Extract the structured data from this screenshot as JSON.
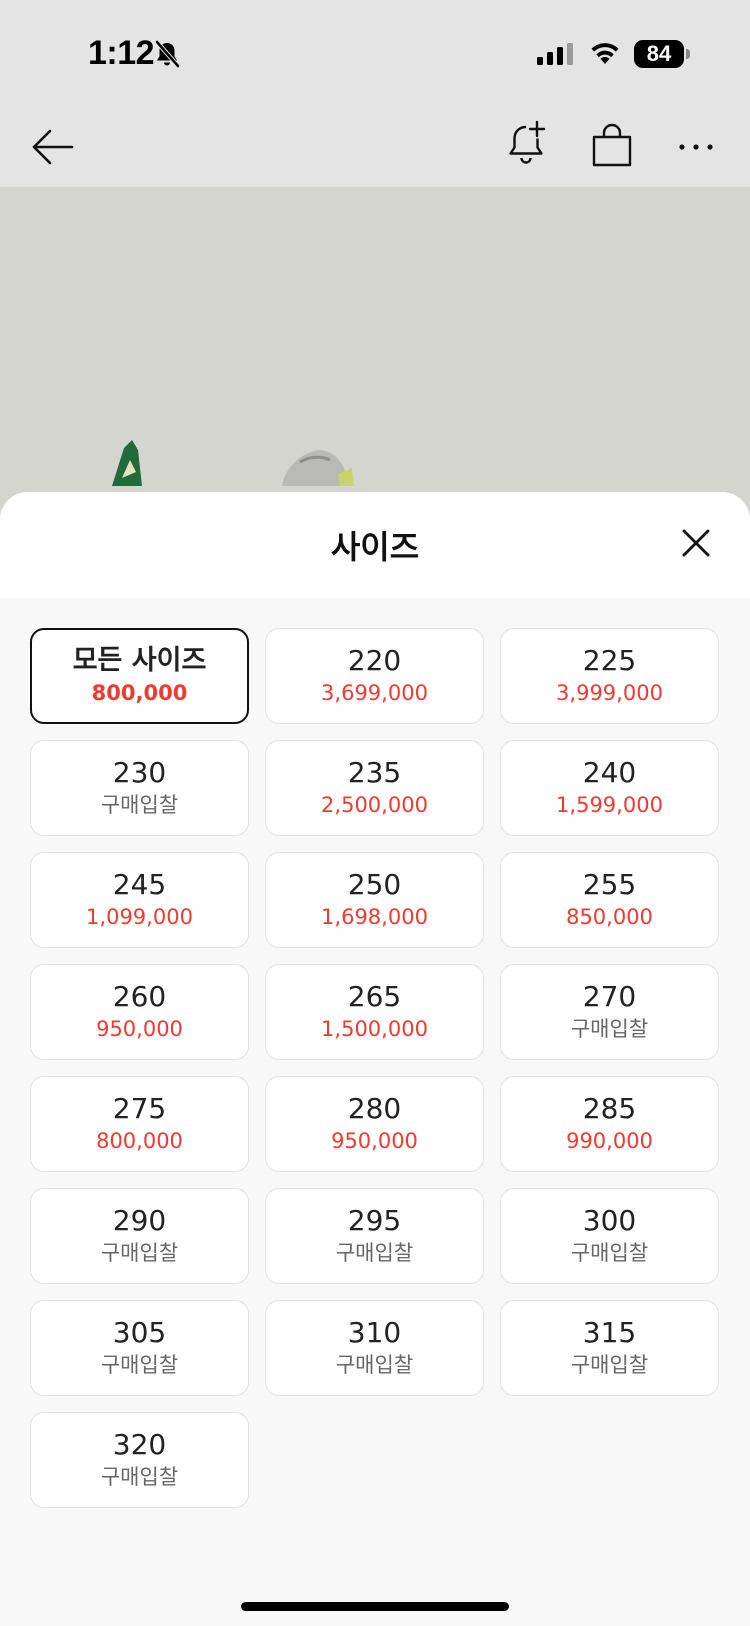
{
  "status_bar": {
    "time": "1:12",
    "battery": "84"
  },
  "sheet": {
    "title": "사이즈"
  },
  "sizes": [
    {
      "label": "모든 사이즈",
      "price": "800,000",
      "type": "price",
      "selected": true
    },
    {
      "label": "220",
      "price": "3,699,000",
      "type": "price"
    },
    {
      "label": "225",
      "price": "3,999,000",
      "type": "price"
    },
    {
      "label": "230",
      "price": "구매입찰",
      "type": "bid"
    },
    {
      "label": "235",
      "price": "2,500,000",
      "type": "price"
    },
    {
      "label": "240",
      "price": "1,599,000",
      "type": "price"
    },
    {
      "label": "245",
      "price": "1,099,000",
      "type": "price"
    },
    {
      "label": "250",
      "price": "1,698,000",
      "type": "price"
    },
    {
      "label": "255",
      "price": "850,000",
      "type": "price"
    },
    {
      "label": "260",
      "price": "950,000",
      "type": "price"
    },
    {
      "label": "265",
      "price": "1,500,000",
      "type": "price"
    },
    {
      "label": "270",
      "price": "구매입찰",
      "type": "bid"
    },
    {
      "label": "275",
      "price": "800,000",
      "type": "price"
    },
    {
      "label": "280",
      "price": "950,000",
      "type": "price"
    },
    {
      "label": "285",
      "price": "990,000",
      "type": "price"
    },
    {
      "label": "290",
      "price": "구매입찰",
      "type": "bid"
    },
    {
      "label": "295",
      "price": "구매입찰",
      "type": "bid"
    },
    {
      "label": "300",
      "price": "구매입찰",
      "type": "bid"
    },
    {
      "label": "305",
      "price": "구매입찰",
      "type": "bid"
    },
    {
      "label": "310",
      "price": "구매입찰",
      "type": "bid"
    },
    {
      "label": "315",
      "price": "구매입찰",
      "type": "bid"
    },
    {
      "label": "320",
      "price": "구매입찰",
      "type": "bid"
    }
  ],
  "colors": {
    "price": "#ef3a2f",
    "bid": "#666666",
    "selected_border": "#111111"
  },
  "icons": {
    "back": "arrow-left-icon",
    "alert": "bell-plus-icon",
    "cart": "shopping-bag-icon",
    "more": "more-horizontal-icon",
    "close": "close-icon"
  }
}
